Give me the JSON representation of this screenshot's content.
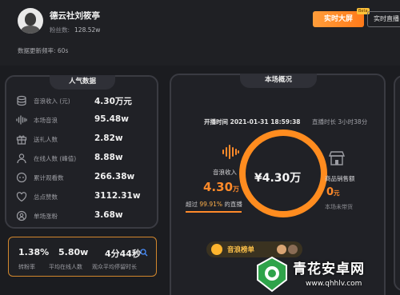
{
  "header": {
    "host_name": "德云社刘筱亭",
    "fans_label": "粉丝数:",
    "fans_value": "128.52w",
    "update_freq": "数据更新频率: 60s",
    "live_screen_button": "实时大屏",
    "beta_badge": "Beta",
    "realtime_button": "实时直播"
  },
  "popularity": {
    "title": "人气数据",
    "metrics": [
      {
        "icon": "coins-stack-icon",
        "label": "音浪收入 (元)",
        "value": "4.30万元"
      },
      {
        "icon": "sound-wave-icon",
        "label": "本场音浪",
        "value": "95.48w"
      },
      {
        "icon": "gift-icon",
        "label": "送礼人数",
        "value": "2.82w"
      },
      {
        "icon": "person-icon",
        "label": "在线人数 (峰值)",
        "value": "8.88w"
      },
      {
        "icon": "eye-icon",
        "label": "累计观看数",
        "value": "266.38w"
      },
      {
        "icon": "heart-icon",
        "label": "总点赞数",
        "value": "3112.31w"
      },
      {
        "icon": "user-plus-icon",
        "label": "单场涨粉",
        "value": "3.68w"
      }
    ],
    "bottom": {
      "conversion_value": "1.38%",
      "conversion_label": "转粉率",
      "avg_online_value": "5.80w",
      "avg_online_label": "平均在线人数",
      "avg_stay_value": "4分44秒",
      "avg_stay_label": "观众平均停留时长"
    }
  },
  "overview": {
    "title": "本场概况",
    "start_time": "开播时间 2021-01-31 18:59:38",
    "duration": "直播时长 3小时38分",
    "revenue_label": "音浪收入",
    "revenue_value": "4.30",
    "revenue_unit": "万",
    "beyond_text_prefix": "超过",
    "beyond_pct": "99.91%",
    "beyond_text_suffix": "的直播",
    "center_value": "¥4.30万",
    "sales_label": "商品销售额",
    "sales_value": "0",
    "sales_unit": "元",
    "sales_sub": "本场未带货",
    "rank_text": "音浪榜单"
  },
  "watermark": {
    "title": "青花安卓网",
    "url": "www.qhhlv.com"
  },
  "colors": {
    "accent_orange": "#ff8a2a",
    "panel_border": "#3a3b42",
    "background": "#1b1c20"
  }
}
